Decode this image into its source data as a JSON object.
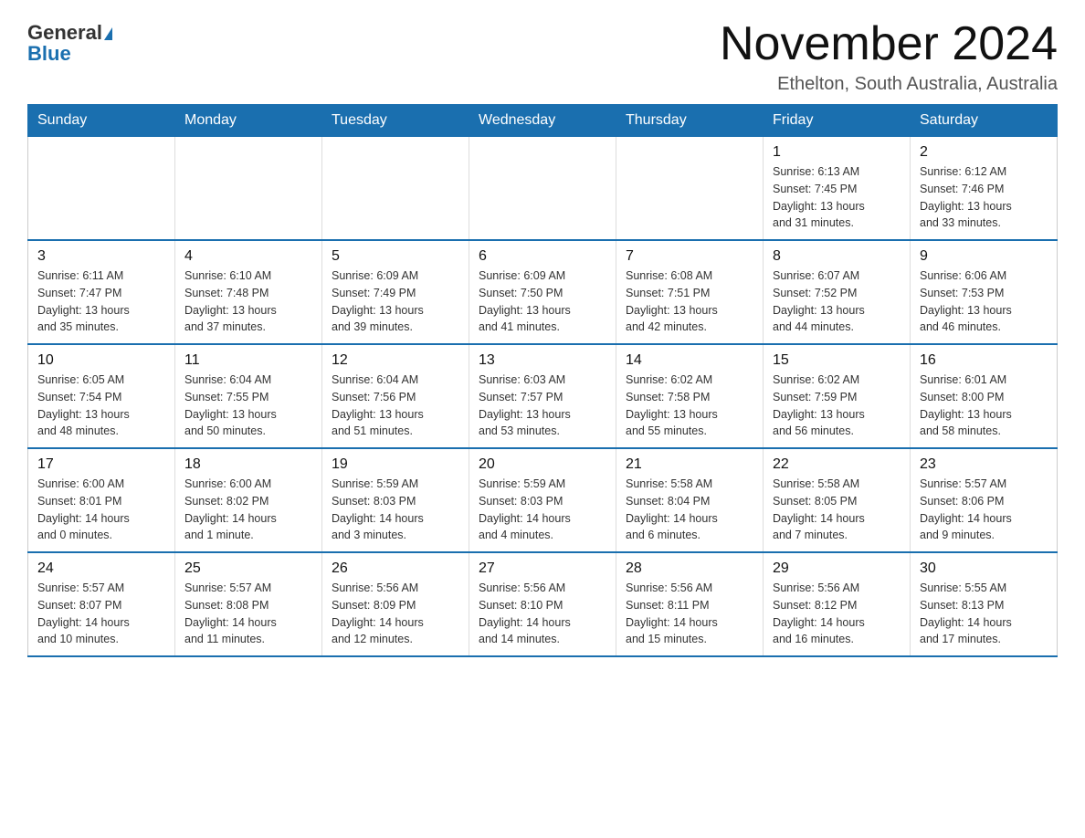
{
  "logo": {
    "general": "General",
    "blue": "Blue"
  },
  "title": "November 2024",
  "location": "Ethelton, South Australia, Australia",
  "days_of_week": [
    "Sunday",
    "Monday",
    "Tuesday",
    "Wednesday",
    "Thursday",
    "Friday",
    "Saturday"
  ],
  "weeks": [
    [
      {
        "day": "",
        "info": ""
      },
      {
        "day": "",
        "info": ""
      },
      {
        "day": "",
        "info": ""
      },
      {
        "day": "",
        "info": ""
      },
      {
        "day": "",
        "info": ""
      },
      {
        "day": "1",
        "info": "Sunrise: 6:13 AM\nSunset: 7:45 PM\nDaylight: 13 hours\nand 31 minutes."
      },
      {
        "day": "2",
        "info": "Sunrise: 6:12 AM\nSunset: 7:46 PM\nDaylight: 13 hours\nand 33 minutes."
      }
    ],
    [
      {
        "day": "3",
        "info": "Sunrise: 6:11 AM\nSunset: 7:47 PM\nDaylight: 13 hours\nand 35 minutes."
      },
      {
        "day": "4",
        "info": "Sunrise: 6:10 AM\nSunset: 7:48 PM\nDaylight: 13 hours\nand 37 minutes."
      },
      {
        "day": "5",
        "info": "Sunrise: 6:09 AM\nSunset: 7:49 PM\nDaylight: 13 hours\nand 39 minutes."
      },
      {
        "day": "6",
        "info": "Sunrise: 6:09 AM\nSunset: 7:50 PM\nDaylight: 13 hours\nand 41 minutes."
      },
      {
        "day": "7",
        "info": "Sunrise: 6:08 AM\nSunset: 7:51 PM\nDaylight: 13 hours\nand 42 minutes."
      },
      {
        "day": "8",
        "info": "Sunrise: 6:07 AM\nSunset: 7:52 PM\nDaylight: 13 hours\nand 44 minutes."
      },
      {
        "day": "9",
        "info": "Sunrise: 6:06 AM\nSunset: 7:53 PM\nDaylight: 13 hours\nand 46 minutes."
      }
    ],
    [
      {
        "day": "10",
        "info": "Sunrise: 6:05 AM\nSunset: 7:54 PM\nDaylight: 13 hours\nand 48 minutes."
      },
      {
        "day": "11",
        "info": "Sunrise: 6:04 AM\nSunset: 7:55 PM\nDaylight: 13 hours\nand 50 minutes."
      },
      {
        "day": "12",
        "info": "Sunrise: 6:04 AM\nSunset: 7:56 PM\nDaylight: 13 hours\nand 51 minutes."
      },
      {
        "day": "13",
        "info": "Sunrise: 6:03 AM\nSunset: 7:57 PM\nDaylight: 13 hours\nand 53 minutes."
      },
      {
        "day": "14",
        "info": "Sunrise: 6:02 AM\nSunset: 7:58 PM\nDaylight: 13 hours\nand 55 minutes."
      },
      {
        "day": "15",
        "info": "Sunrise: 6:02 AM\nSunset: 7:59 PM\nDaylight: 13 hours\nand 56 minutes."
      },
      {
        "day": "16",
        "info": "Sunrise: 6:01 AM\nSunset: 8:00 PM\nDaylight: 13 hours\nand 58 minutes."
      }
    ],
    [
      {
        "day": "17",
        "info": "Sunrise: 6:00 AM\nSunset: 8:01 PM\nDaylight: 14 hours\nand 0 minutes."
      },
      {
        "day": "18",
        "info": "Sunrise: 6:00 AM\nSunset: 8:02 PM\nDaylight: 14 hours\nand 1 minute."
      },
      {
        "day": "19",
        "info": "Sunrise: 5:59 AM\nSunset: 8:03 PM\nDaylight: 14 hours\nand 3 minutes."
      },
      {
        "day": "20",
        "info": "Sunrise: 5:59 AM\nSunset: 8:03 PM\nDaylight: 14 hours\nand 4 minutes."
      },
      {
        "day": "21",
        "info": "Sunrise: 5:58 AM\nSunset: 8:04 PM\nDaylight: 14 hours\nand 6 minutes."
      },
      {
        "day": "22",
        "info": "Sunrise: 5:58 AM\nSunset: 8:05 PM\nDaylight: 14 hours\nand 7 minutes."
      },
      {
        "day": "23",
        "info": "Sunrise: 5:57 AM\nSunset: 8:06 PM\nDaylight: 14 hours\nand 9 minutes."
      }
    ],
    [
      {
        "day": "24",
        "info": "Sunrise: 5:57 AM\nSunset: 8:07 PM\nDaylight: 14 hours\nand 10 minutes."
      },
      {
        "day": "25",
        "info": "Sunrise: 5:57 AM\nSunset: 8:08 PM\nDaylight: 14 hours\nand 11 minutes."
      },
      {
        "day": "26",
        "info": "Sunrise: 5:56 AM\nSunset: 8:09 PM\nDaylight: 14 hours\nand 12 minutes."
      },
      {
        "day": "27",
        "info": "Sunrise: 5:56 AM\nSunset: 8:10 PM\nDaylight: 14 hours\nand 14 minutes."
      },
      {
        "day": "28",
        "info": "Sunrise: 5:56 AM\nSunset: 8:11 PM\nDaylight: 14 hours\nand 15 minutes."
      },
      {
        "day": "29",
        "info": "Sunrise: 5:56 AM\nSunset: 8:12 PM\nDaylight: 14 hours\nand 16 minutes."
      },
      {
        "day": "30",
        "info": "Sunrise: 5:55 AM\nSunset: 8:13 PM\nDaylight: 14 hours\nand 17 minutes."
      }
    ]
  ]
}
